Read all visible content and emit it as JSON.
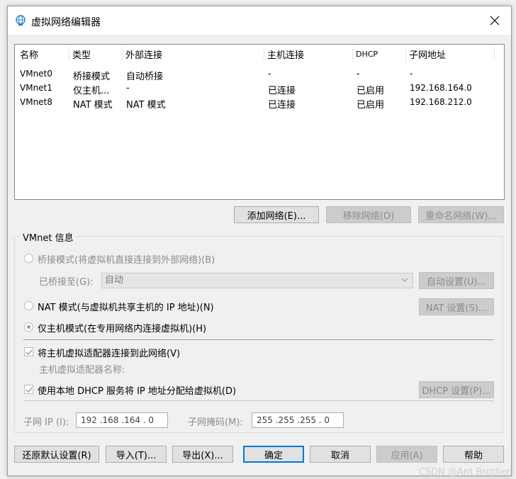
{
  "window": {
    "title": "虚拟网络编辑器"
  },
  "network_list": {
    "columns": [
      "名称",
      "类型",
      "外部连接",
      "主机连接",
      "DHCP",
      "子网地址"
    ],
    "rows": [
      {
        "name": "VMnet0",
        "type": "桥接模式",
        "external": "自动桥接",
        "host": "-",
        "dhcp": "-",
        "subnet": "-"
      },
      {
        "name": "VMnet1",
        "type": "仅主机...",
        "external": "-",
        "host": "已连接",
        "dhcp": "已启用",
        "subnet": "192.168.164.0"
      },
      {
        "name": "VMnet8",
        "type": "NAT 模式",
        "external": "NAT 模式",
        "host": "已连接",
        "dhcp": "已启用",
        "subnet": "192.168.212.0"
      }
    ]
  },
  "list_buttons": {
    "add": "添加网络(E)...",
    "remove": "移除网络(O)",
    "rename": "重命名网络(W)..."
  },
  "vmnet_info": {
    "title": "VMnet 信息",
    "bridge_label": "桥接模式(将虚拟机直接连接到外部网络)(B)",
    "bridged_to_label": "已桥接至(G):",
    "bridged_to_value": "自动",
    "auto_settings": "自动设置(U)...",
    "nat_label": "NAT 模式(与虚拟机共享主机的 IP 地址)(N)",
    "nat_settings": "NAT 设置(S)...",
    "hostonly_label": "仅主机模式(在专用网络内连接虚拟机)(H)",
    "connect_adapter_label": "将主机虚拟适配器连接到此网络(V)",
    "adapter_name_label": "主机虚拟适配器名称:",
    "dhcp_label": "使用本地 DHCP 服务将 IP 地址分配给虚拟机(D)",
    "dhcp_settings": "DHCP 设置(P)...",
    "subnet_ip_label": "子网 IP (I):",
    "subnet_ip_value": "192 .168 .164 .  0",
    "subnet_mask_label": "子网掩码(M):",
    "subnet_mask_value": "255 .255 .255 .  0"
  },
  "footer": {
    "restore": "还原默认设置(R)",
    "import": "导入(T)...",
    "export": "导出(X)...",
    "ok": "确定",
    "cancel": "取消",
    "apply": "应用(A)",
    "help": "帮助"
  },
  "watermark": "CSDN @Ant Brother",
  "colors": {
    "focus_border": "#0078d7",
    "disabled_text": "#8c8c8c"
  }
}
